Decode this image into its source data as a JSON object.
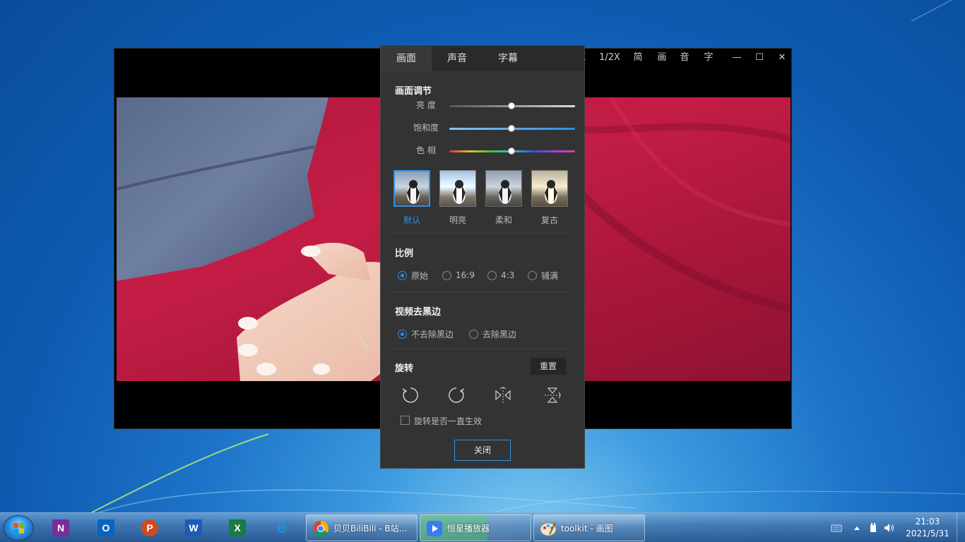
{
  "player": {
    "titlebar": {
      "speed": "1/2X",
      "simplified": "简",
      "picture": "画",
      "audio": "音",
      "subtitle": "字",
      "minimize": "—",
      "maximize": "☐",
      "close": "✕",
      "partial": "X"
    }
  },
  "panel": {
    "tabs": [
      {
        "label": "画面",
        "active": true
      },
      {
        "label": "声音",
        "active": false
      },
      {
        "label": "字幕",
        "active": false
      }
    ],
    "picture_adjust": {
      "title": "画面调节",
      "sliders": [
        {
          "label": "亮  度",
          "value": 0.5
        },
        {
          "label": "饱和度",
          "value": 0.5
        },
        {
          "label": "色  相",
          "value": 0.5
        }
      ],
      "presets": [
        {
          "label": "默认",
          "selected": true
        },
        {
          "label": "明亮",
          "selected": false
        },
        {
          "label": "柔和",
          "selected": false
        },
        {
          "label": "复古",
          "selected": false
        }
      ]
    },
    "ratio": {
      "title": "比例",
      "options": [
        {
          "label": "原始",
          "checked": true
        },
        {
          "label": "16:9",
          "checked": false
        },
        {
          "label": "4:3",
          "checked": false
        },
        {
          "label": "铺满",
          "checked": false
        }
      ]
    },
    "black_border": {
      "title": "视频去黑边",
      "options": [
        {
          "label": "不去除黑边",
          "checked": true
        },
        {
          "label": "去除黑边",
          "checked": false
        }
      ]
    },
    "rotate": {
      "title": "旋转",
      "reset_label": "重置",
      "icons": [
        "rotate-left-icon",
        "rotate-right-icon",
        "flip-horizontal-icon",
        "flip-vertical-icon"
      ],
      "persist_label": "旋转是否一直生效",
      "persist_checked": false
    },
    "close_label": "关闭"
  },
  "taskbar": {
    "pinned": [
      {
        "name": "onenote",
        "letter": "N",
        "color": "#7b2c9c"
      },
      {
        "name": "outlook",
        "letter": "O",
        "color": "#0a64c0"
      },
      {
        "name": "powerpoint",
        "letter": "P",
        "color": "#d04a20"
      },
      {
        "name": "word",
        "letter": "W",
        "color": "#1e5bb8"
      },
      {
        "name": "excel",
        "letter": "X",
        "color": "#1d7a40"
      },
      {
        "name": "ie",
        "letter": "e",
        "color": "#1e8fe0"
      }
    ],
    "tasks": [
      {
        "label": "贝贝BiliBili - B站...",
        "icon": "chrome-icon"
      },
      {
        "label": "恒星播放器",
        "icon": "player-icon"
      },
      {
        "label": "toolkit - 画图",
        "icon": "paint-icon"
      }
    ],
    "clock": {
      "time": "21:03",
      "date": "2021/5/31"
    }
  }
}
